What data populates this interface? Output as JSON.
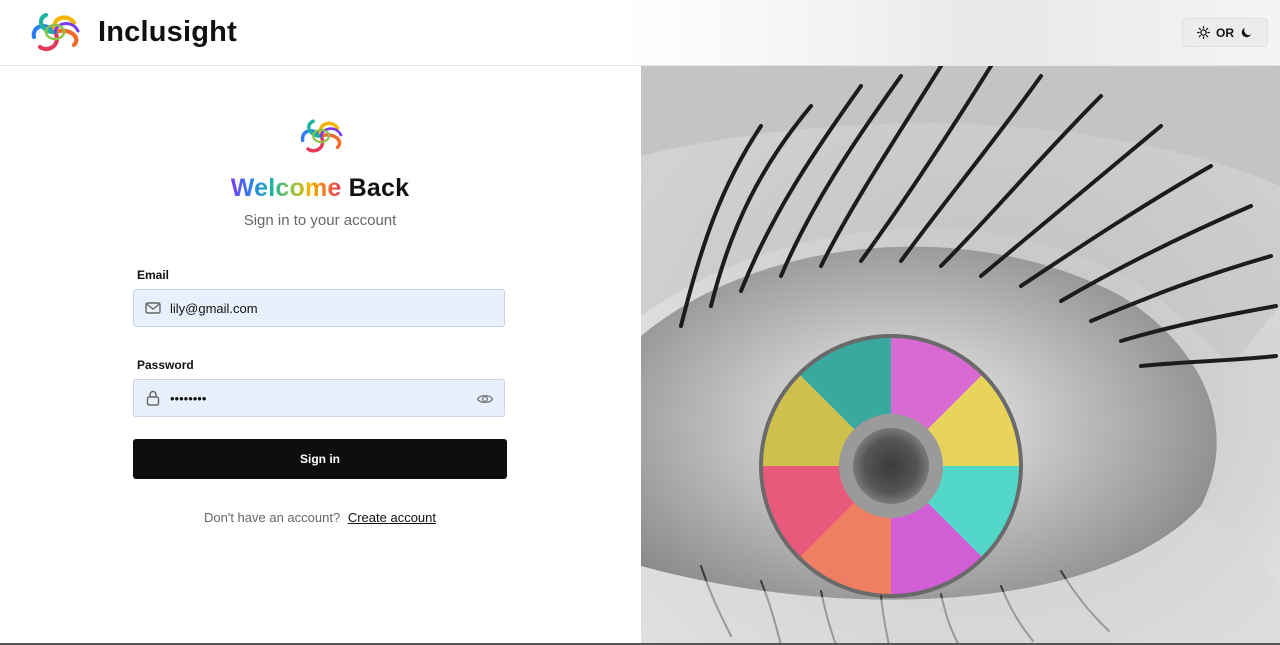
{
  "header": {
    "brand_name": "Inclusight",
    "logo_icon": "swirl-logo-icon",
    "theme_toggle": {
      "label": "OR",
      "light_icon": "sun-icon",
      "dark_icon": "moon-icon"
    }
  },
  "login": {
    "title_part1": "Welcome",
    "title_part2": "Back",
    "subtitle": "Sign in to your account",
    "email": {
      "label": "Email",
      "value": "lily@gmail.com",
      "icon": "mail-icon"
    },
    "password": {
      "label": "Password",
      "value": "••••••••",
      "icon": "lock-icon",
      "toggle_icon": "eye-icon"
    },
    "submit_label": "Sign in",
    "footer_text": "Don't have an account?",
    "footer_link": "Create account"
  },
  "colors": {
    "button_bg": "#0e0e0e",
    "input_bg": "#e8f0fe",
    "title_rainbow": [
      "#7a3cf0",
      "#2e7ef5",
      "#1db4a0",
      "#8bc34a",
      "#f4b400",
      "#f06a2a",
      "#e5395a"
    ]
  },
  "hero_image": {
    "icon": "rainbow-eye-image"
  }
}
